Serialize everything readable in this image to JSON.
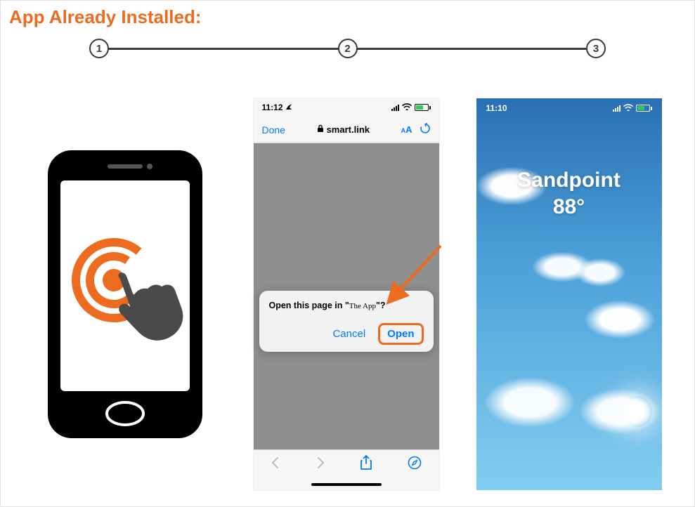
{
  "title": "App Already Installed:",
  "steps": [
    "1",
    "2",
    "3"
  ],
  "panel2": {
    "status_time": "11:12",
    "status_location_icon": "location-arrow",
    "url_done": "Done",
    "url_domain": "smart.link",
    "url_aa": "AA",
    "alert_prefix": "Open this page in \"",
    "alert_appname": "The App",
    "alert_suffix": "\"?",
    "btn_cancel": "Cancel",
    "btn_open": "Open"
  },
  "panel3": {
    "status_time": "11:10",
    "city": "Sandpoint",
    "temperature": "88°"
  },
  "colors": {
    "accent": "#ed6b1f",
    "ios_blue": "#007aff"
  }
}
